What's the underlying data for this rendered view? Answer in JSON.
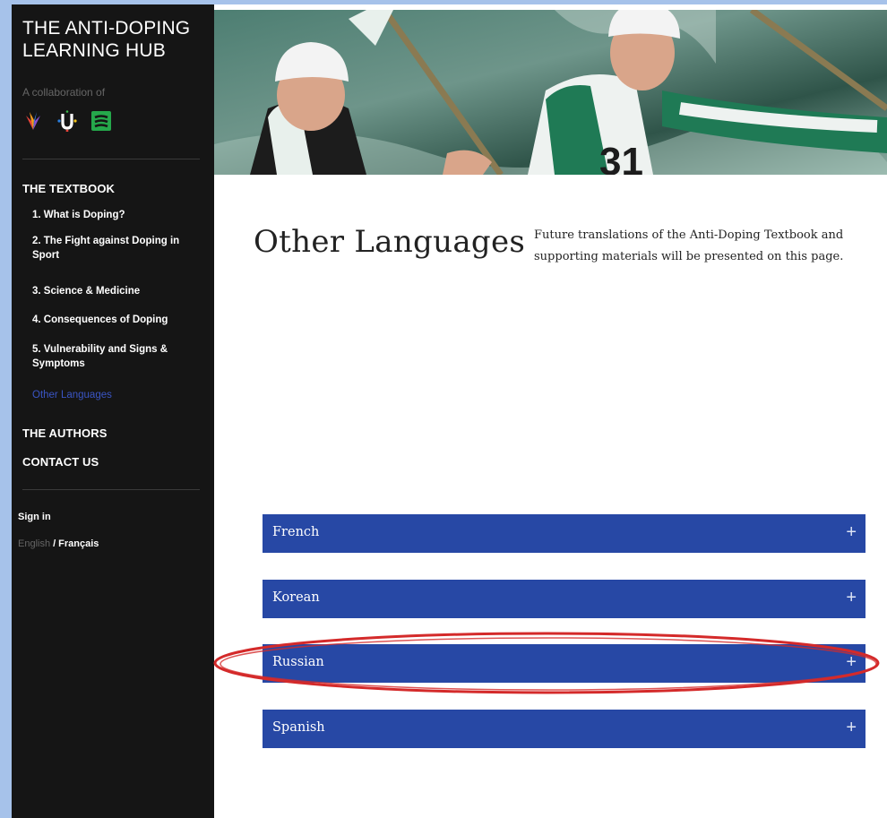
{
  "site": {
    "title": "THE ANTI-DOPING LEARNING HUB",
    "collab_text": "A collaboration of",
    "logos": [
      "fier-logo-icon",
      "university-logo-icon",
      "green-stripe-logo-icon"
    ]
  },
  "nav": {
    "textbook_heading": "THE TEXTBOOK",
    "items": [
      {
        "label": "1. What is Doping?"
      },
      {
        "label": "2. The Fight against Doping in Sport"
      },
      {
        "label": "3. Science & Medicine"
      },
      {
        "label": "4. Consequences of Doping"
      },
      {
        "label": "5. Vulnerability and Signs & Symptoms"
      },
      {
        "label": "Other Languages",
        "active": true
      }
    ],
    "authors": "THE AUTHORS",
    "contact": "CONTACT US",
    "signin": "Sign in",
    "lang_en": "English",
    "lang_sep": "/",
    "lang_fr": "Français"
  },
  "hero": {
    "bib_number": "31"
  },
  "main": {
    "title": "Other Languages",
    "intro": "Future translations of the Anti-Doping Textbook and supporting materials will be presented on this page.",
    "accordion": [
      {
        "label": "French",
        "icon": "+"
      },
      {
        "label": "Korean",
        "icon": "+"
      },
      {
        "label": "Russian",
        "icon": "+"
      },
      {
        "label": "Spanish",
        "icon": "+"
      }
    ]
  },
  "colors": {
    "accent": "#2748a5",
    "sidebar_bg": "#151515",
    "active_link": "#3a55c4",
    "annotation": "#d42a2a",
    "outer_bg": "#a6c2ea"
  }
}
